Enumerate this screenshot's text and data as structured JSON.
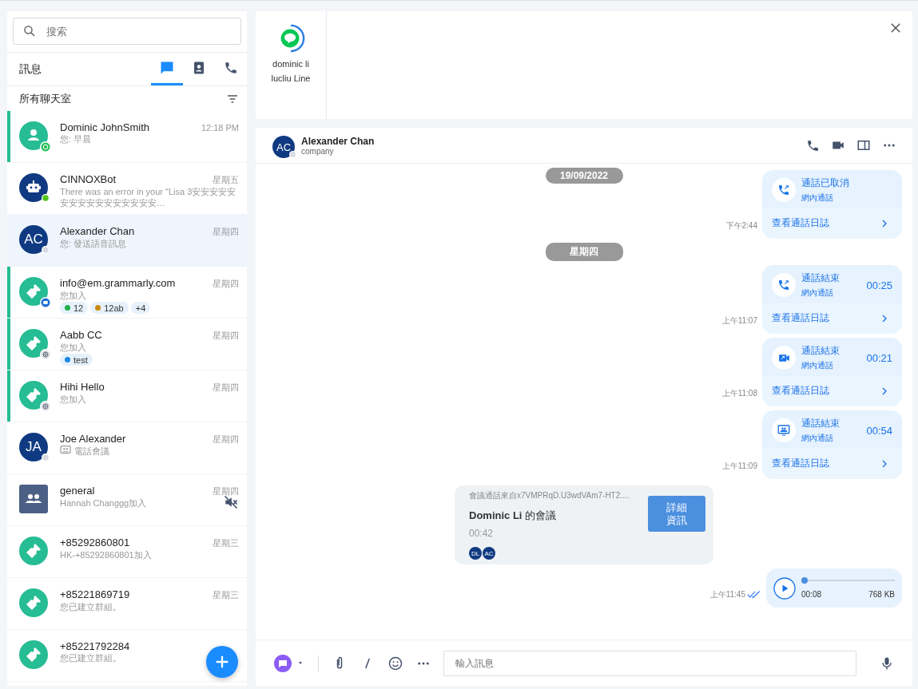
{
  "search": {
    "placeholder": "搜索"
  },
  "sidebar": {
    "title": "訊息",
    "tabs": [
      {
        "kind": "chat",
        "selected": true
      },
      {
        "kind": "contacts",
        "selected": false
      },
      {
        "kind": "calls",
        "selected": false
      }
    ],
    "filter_label": "所有聊天室"
  },
  "chats": [
    {
      "name": "Dominic JohnSmith",
      "preview": "您: 早晨",
      "time": "12:18 PM",
      "avatar": {
        "kind": "person"
      },
      "badge": {
        "kind": "whatsapp"
      },
      "unread": true,
      "selected": false
    },
    {
      "name": "CINNOXBot",
      "preview": "There was an error in your \"Lisa 3安安安安安安安安安安安安安安安安…",
      "time": "星期五",
      "avatar": {
        "kind": "bot"
      },
      "badge": {
        "kind": "online"
      },
      "unread": false,
      "selected": false
    },
    {
      "name": "Alexander Chan",
      "preview": "您: 發送語音訊息",
      "time": "星期四",
      "avatar": {
        "kind": "initials",
        "initials": "AC"
      },
      "badge": {
        "kind": "offline"
      },
      "unread": false,
      "selected": true
    },
    {
      "name": "info@em.grammarly.com",
      "preview": "您加入",
      "time": "星期四",
      "avatar": {
        "kind": "ticket"
      },
      "badge": {
        "kind": "email"
      },
      "unread": true,
      "selected": false,
      "tags": [
        {
          "label": "12",
          "color": "#22b14c"
        },
        {
          "label": "12ab",
          "color": "#c98a0c"
        },
        {
          "label": "+4"
        }
      ]
    },
    {
      "name": "Aabb CC",
      "preview": "您加入",
      "time": "星期四",
      "avatar": {
        "kind": "ticket"
      },
      "badge": {
        "kind": "web"
      },
      "unread": true,
      "selected": false,
      "tags": [
        {
          "label": "test",
          "color": "#1e88e5"
        }
      ]
    },
    {
      "name": "Hihi Hello",
      "preview": "您加入",
      "time": "星期四",
      "avatar": {
        "kind": "ticket"
      },
      "badge": {
        "kind": "web"
      },
      "unread": true,
      "selected": false
    },
    {
      "name": "Joe Alexander",
      "preview": "電話會議",
      "preview_icon": {
        "kind": "meeting"
      },
      "time": "星期四",
      "avatar": {
        "kind": "initials",
        "initials": "JA"
      },
      "badge": {
        "kind": "offline"
      },
      "unread": false,
      "selected": false
    },
    {
      "name": "general",
      "preview": "Hannah Changgg加入",
      "time": "星期四",
      "avatar": {
        "kind": "group"
      },
      "unread": false,
      "selected": false,
      "muted": true
    },
    {
      "name": "+85292860801",
      "preview": "HK-+85292860801加入",
      "time": "星期三",
      "avatar": {
        "kind": "ticket"
      },
      "unread": false,
      "selected": false
    },
    {
      "name": "+85221869719",
      "preview": "您已建立群組。",
      "time": "星期三",
      "avatar": {
        "kind": "ticket"
      },
      "unread": false,
      "selected": false
    },
    {
      "name": "+85221792284",
      "preview": "您已建立群組。",
      "avatar": {
        "kind": "ticket"
      },
      "unread": false,
      "selected": false
    }
  ],
  "channels": [
    {
      "name": "dominic li",
      "sub": "lucliu Line",
      "kind": "line"
    }
  ],
  "conversation": {
    "initials": "AC",
    "name": "Alexander Chan",
    "subtitle": "company",
    "status": {
      "kind": "offline"
    }
  },
  "messages": [
    {
      "kind": "date",
      "label": "19/09/2022"
    },
    {
      "kind": "call",
      "icon": {
        "kind": "voice"
      },
      "title": "通話已取消",
      "subtitle": "網內通話",
      "link": "查看通話日誌",
      "time": "下午2:44"
    },
    {
      "kind": "date",
      "label": "星期四"
    },
    {
      "kind": "call",
      "icon": {
        "kind": "voice"
      },
      "title": "通話結束",
      "subtitle": "網內通話",
      "duration": "00:25",
      "link": "查看通話日誌",
      "time": "上午11:07"
    },
    {
      "kind": "call",
      "icon": {
        "kind": "video"
      },
      "title": "通話結束",
      "subtitle": "網內通話",
      "duration": "00:21",
      "link": "查看通話日誌",
      "time": "上午11:08"
    },
    {
      "kind": "call",
      "icon": {
        "kind": "screen"
      },
      "title": "通話結束",
      "subtitle": "網內通話",
      "duration": "00:54",
      "link": "查看通話日誌",
      "time": "上午11:09"
    },
    {
      "kind": "meeting",
      "source": "會議通話來自x7VMPRqD.U3wdVAm7-HT2....",
      "title": "**Dominic Li** 的會議",
      "duration": "00:42",
      "participants": [
        "DL",
        "AC"
      ],
      "button": "詳細資訊"
    },
    {
      "kind": "voice",
      "level": 0,
      "position": "00:08",
      "size": "768 KB",
      "time": "上午11:45",
      "read": true
    }
  ],
  "composer": {
    "placeholder": "輸入訊息"
  }
}
